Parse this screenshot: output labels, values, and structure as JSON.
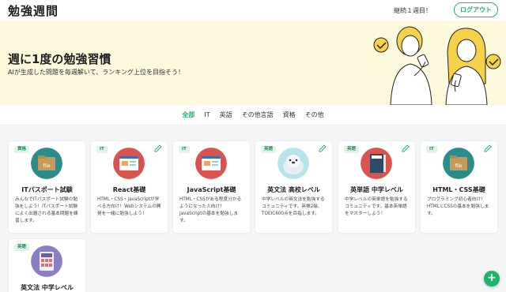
{
  "header": {
    "logo": "勉強週間",
    "streak": "継続１週目！",
    "logout_label": "ログアウト"
  },
  "hero": {
    "title": "週に1度の勉強習慣",
    "subtitle": "AIが生成した問題を毎週解いて、ランキング上位を目指そう！"
  },
  "tabs": [
    {
      "label": "全部",
      "active": true
    },
    {
      "label": "IT",
      "active": false
    },
    {
      "label": "英語",
      "active": false
    },
    {
      "label": "その他言語",
      "active": false
    },
    {
      "label": "資格",
      "active": false
    },
    {
      "label": "その他",
      "active": false
    }
  ],
  "cards": [
    {
      "badge": "資格",
      "title": "ITパスポート試験",
      "desc": "みんなでITパスポート試験の勉強をしよう！ITパスポート試験によく出題される基本問題を練習します。",
      "icon": "file-folder-icon",
      "thumb_color": "#2e8b8b",
      "editable": false
    },
    {
      "badge": "IT",
      "title": "React基礎",
      "desc": "HTML・CSS・JavaScriptが学べる方向け！Webシステムの開発を一緒に勉強しよう！",
      "icon": "web-browser-icon",
      "thumb_color": "#d9534f",
      "editable": true
    },
    {
      "badge": "IT",
      "title": "JavaScript基礎",
      "desc": "HTML・CSSがある程度分かるようになった人向け！JavaScriptの基本を勉強します。",
      "icon": "web-browser-icon",
      "thumb_color": "#d9534f",
      "editable": false
    },
    {
      "badge": "英語",
      "title": "英文法 高校レベル",
      "desc": "中学レベルの英文法を勉強するコミュニティです。英検2級、TOEIC600点を目指します。",
      "icon": "seal-icon",
      "thumb_color": "#b9e3ea",
      "editable": true
    },
    {
      "badge": "英語",
      "title": "英単語 中学レベル",
      "desc": "中学レベルの英単語を勉強するコミュニティです。基本英単語をマスターしよう！",
      "icon": "book-icon",
      "thumb_color": "#d9534f",
      "editable": true
    },
    {
      "badge": "IT",
      "title": "HTML・CSS基礎",
      "desc": "プログラミング初心者向け！HTMLとCSSの基本を勉強します。",
      "icon": "file-folder-icon",
      "thumb_color": "#2e8b8b",
      "editable": true
    },
    {
      "badge": "英語",
      "title": "英文法 中学レベル",
      "desc": "",
      "icon": "calculator-icon",
      "thumb_color": "#8a7fc7",
      "editable": false
    }
  ],
  "fab_label": "+",
  "colors": {
    "accent": "#21b26b",
    "hero_bg": "#fdf9dc"
  }
}
